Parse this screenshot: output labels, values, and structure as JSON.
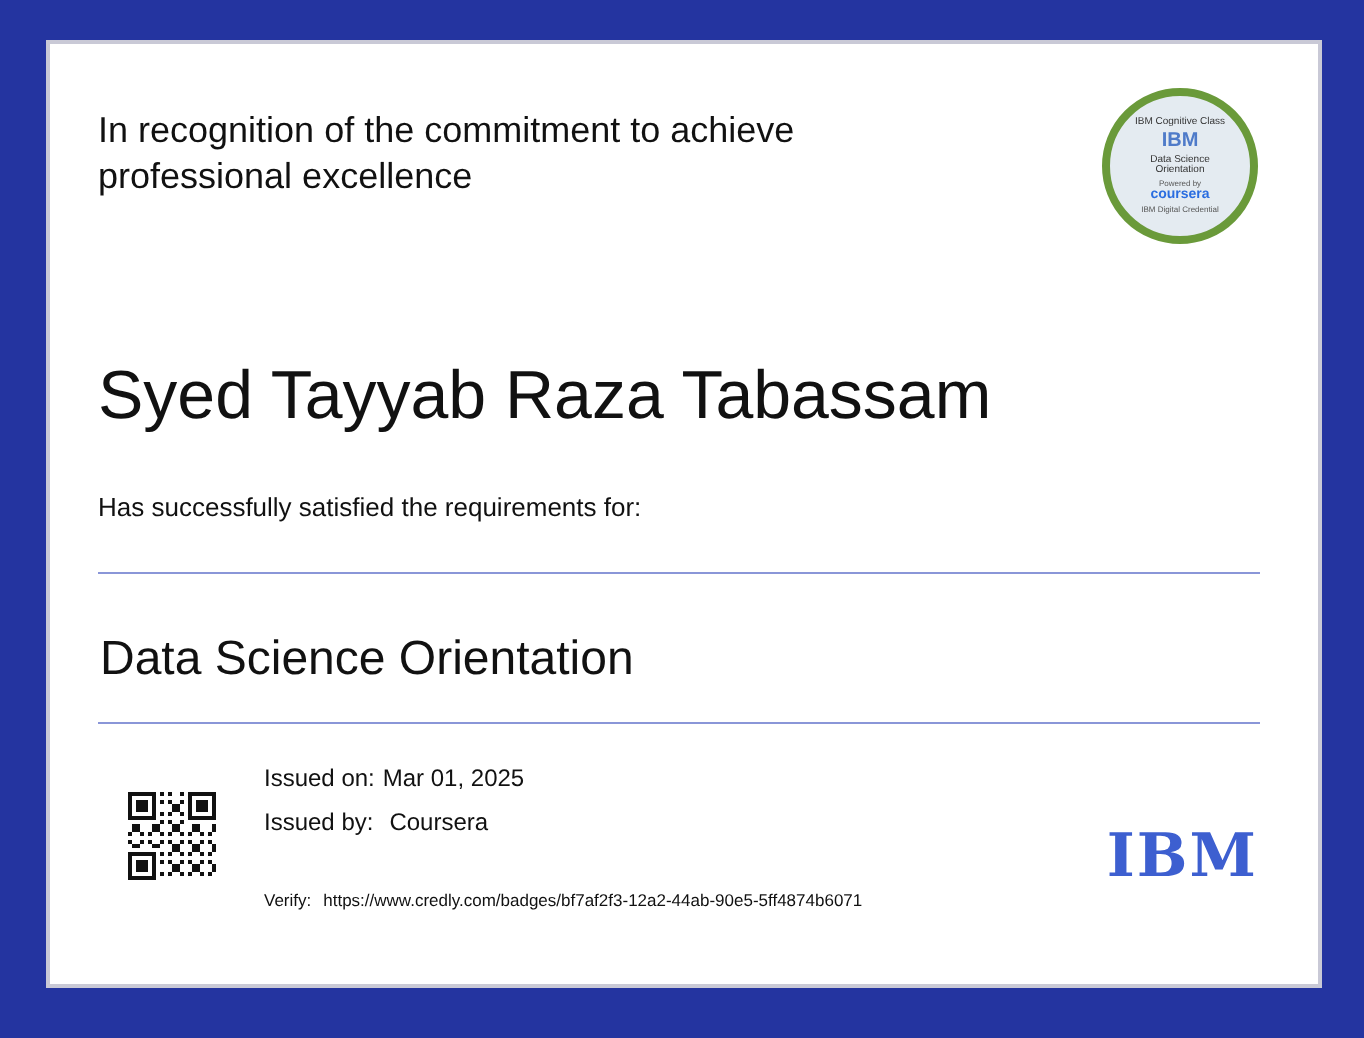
{
  "recognition": "In recognition of the commitment to achieve professional excellence",
  "badge": {
    "arc_top": "IBM Cognitive Class",
    "brand": "IBM",
    "title": "Data Science Orientation",
    "powered": "Powered by",
    "partner": "coursera",
    "arc_bottom": "IBM Digital Credential"
  },
  "recipient": "Syed Tayyab Raza Tabassam",
  "statement": "Has successfully satisfied the requirements for:",
  "course": "Data Science Orientation",
  "issued_on": {
    "label": "Issued on:",
    "value": "Mar 01, 2025"
  },
  "issued_by": {
    "label": "Issued by:",
    "value": "Coursera"
  },
  "verify": {
    "label": "Verify:",
    "url": "https://www.credly.com/badges/bf7af2f3-12a2-44ab-90e5-5ff4874b6071"
  },
  "logo": "IBM"
}
